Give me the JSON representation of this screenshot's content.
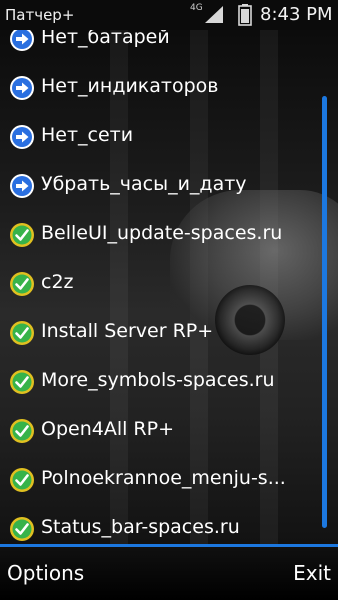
{
  "status_bar": {
    "app_title": "Патчер+",
    "network_type": "4G",
    "time": "8:43 PM"
  },
  "list": {
    "items": [
      {
        "label": "Нет_батарей",
        "icon": "blue-arrow-icon"
      },
      {
        "label": "Нет_индикаторов",
        "icon": "blue-arrow-icon"
      },
      {
        "label": "Нет_сети",
        "icon": "blue-arrow-icon"
      },
      {
        "label": "Убрать_часы_и_дату",
        "icon": "blue-arrow-icon"
      },
      {
        "label": "BelleUI_update-spaces.ru",
        "icon": "green-check-icon"
      },
      {
        "label": "c2z",
        "icon": "green-check-icon"
      },
      {
        "label": "Install Server RP+",
        "icon": "green-check-icon"
      },
      {
        "label": "More_symbols-spaces.ru",
        "icon": "green-check-icon"
      },
      {
        "label": "Open4All RP+",
        "icon": "green-check-icon"
      },
      {
        "label": "Polnoekrannoe_menju-s...",
        "icon": "green-check-icon"
      },
      {
        "label": "Status_bar-spaces.ru",
        "icon": "green-check-icon"
      }
    ]
  },
  "softkeys": {
    "left": "Options",
    "right": "Exit"
  },
  "colors": {
    "accent": "#1c78e0",
    "check_green": "#37b34a",
    "check_ring": "#e0c020",
    "arrow_blue": "#2a6fe0"
  }
}
